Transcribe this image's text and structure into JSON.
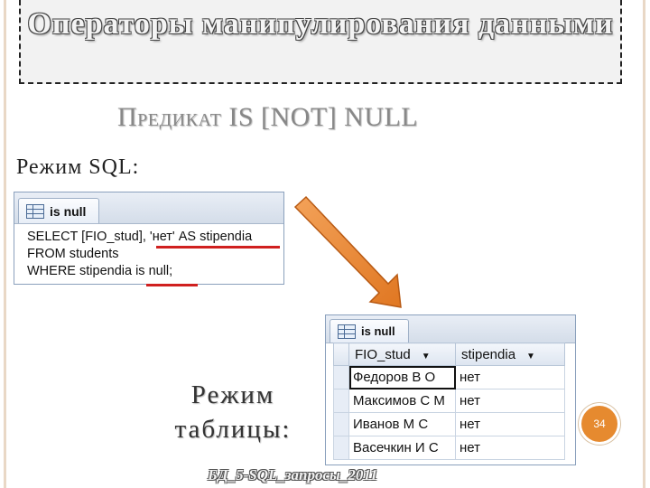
{
  "slide": {
    "title": "Операторы  манипулирования данными",
    "subtitle_cap": "П",
    "subtitle_small": "РЕДИКАТ",
    "subtitle_rest": " IS [NOT] NULL",
    "mode_sql_label": "Режим SQL:",
    "mode_table_label": "Режим таблицы:",
    "footer": "БД_5-SQL_запросы_2011",
    "page_number": "34",
    "accent_color": "#e68a2f",
    "underline_color": "#d0201f"
  },
  "sql_window": {
    "tab_icon": "table-grid-icon",
    "tab_label": "is null",
    "lines": [
      "SELECT [FIO_stud], 'нет' AS stipendia",
      "FROM students",
      "WHERE stipendia is null;"
    ]
  },
  "table_window": {
    "tab_icon": "table-grid-icon",
    "tab_label": "is null",
    "columns": [
      "FIO_stud",
      "stipendia"
    ],
    "rows": [
      [
        "Федоров В О",
        "нет"
      ],
      [
        "Максимов С М",
        "нет"
      ],
      [
        "Иванов М С",
        "нет"
      ],
      [
        "Васечкин И С",
        "нет"
      ]
    ]
  }
}
